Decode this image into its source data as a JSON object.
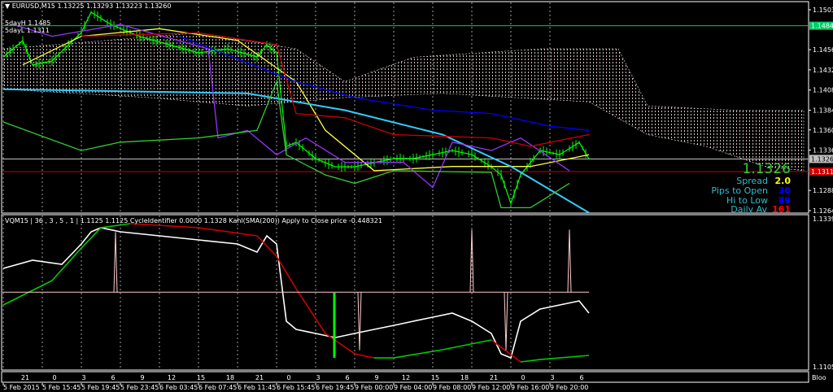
{
  "window": {
    "symbol_header": "EURUSD,M15",
    "ohlc": [
      "1.13225",
      "1.13293",
      "1.13223",
      "1.13260"
    ]
  },
  "labels": {
    "five_day_high": "5dayH 1.1485",
    "five_day_low": "5dayL 1.1311"
  },
  "info_panel": {
    "price": "1.1326",
    "rows": [
      {
        "label": "Spread",
        "value": "2.0",
        "color": "#ffff00"
      },
      {
        "label": "Pips to Open",
        "value": "30",
        "color": "#0000ff"
      },
      {
        "label": "Hi to Low",
        "value": "89",
        "color": "#0000ff"
      },
      {
        "label": "Daily Av",
        "value": "161",
        "color": "#ff0000"
      }
    ]
  },
  "indicator_header": "VQM15 | 36 , 3 , 5 , 1 |  1.1125 1.1125  CycleIdentifier 0.0000 1.1328  Kahl(SMA(200)) Apply to Close price -0.448321",
  "chart_data": [
    {
      "type": "line",
      "title": "EURUSD,M15",
      "ylim": [
        1.12645,
        1.15035
      ],
      "price_ticks": [
        "1.15035",
        "1.14560",
        "1.14320",
        "1.14080",
        "1.13840",
        "1.13605",
        "1.13365",
        "1.12885",
        "1.12645"
      ],
      "hlines": [
        {
          "name": "5day-high",
          "value": 1.14845,
          "label": "1.14845",
          "color": "#00cc66"
        },
        {
          "name": "bid",
          "value": 1.1326,
          "label": "1.13260",
          "color": "#c0c0c0"
        },
        {
          "name": "5day-low",
          "value": 1.1311,
          "label": "1.13110",
          "color": "#cc0000"
        }
      ],
      "series": [
        {
          "name": "price",
          "color": "#00ff00",
          "points": [
            [
              0,
              1.14474
            ],
            [
              1,
              1.1457
            ],
            [
              2,
              1.14667
            ],
            [
              3,
              1.14377
            ],
            [
              5,
              1.14425
            ],
            [
              8,
              1.14764
            ],
            [
              9,
              1.15006
            ],
            [
              11,
              1.14861
            ],
            [
              14,
              1.14716
            ],
            [
              17,
              1.14619
            ],
            [
              20,
              1.14522
            ],
            [
              23,
              1.1457
            ],
            [
              26,
              1.14474
            ],
            [
              27,
              1.14619
            ],
            [
              28,
              1.14522
            ],
            [
              29,
              1.13409
            ],
            [
              30,
              1.13457
            ],
            [
              32,
              1.13264
            ],
            [
              34,
              1.13167
            ],
            [
              36,
              1.13167
            ],
            [
              38,
              1.13215
            ],
            [
              40,
              1.13264
            ],
            [
              42,
              1.13264
            ],
            [
              44,
              1.13312
            ],
            [
              46,
              1.1336
            ],
            [
              48,
              1.13312
            ],
            [
              50,
              1.13167
            ],
            [
              51,
              1.1307
            ],
            [
              52,
              1.12731
            ],
            [
              53,
              1.1307
            ],
            [
              55,
              1.1336
            ],
            [
              57,
              1.13312
            ],
            [
              59,
              1.13457
            ],
            [
              60,
              1.1326
            ]
          ]
        },
        {
          "name": "yellow-ma",
          "color": "#ffff40",
          "points": [
            [
              2,
              1.1438
            ],
            [
              8,
              1.1472
            ],
            [
              16,
              1.1481
            ],
            [
              24,
              1.1467
            ],
            [
              30,
              1.1418
            ],
            [
              33,
              1.136
            ],
            [
              38,
              1.1312
            ],
            [
              46,
              1.1317
            ],
            [
              54,
              1.1317
            ],
            [
              60,
              1.1331
            ]
          ]
        },
        {
          "name": "cyan-ma",
          "color": "#33ccff",
          "points": [
            [
              0,
              1.1409
            ],
            [
              25,
              1.1404
            ],
            [
              35,
              1.1384
            ],
            [
              45,
              1.1355
            ],
            [
              52,
              1.1317
            ],
            [
              60,
              1.1262
            ]
          ]
        },
        {
          "name": "purple",
          "color": "#9933ff",
          "points": [
            [
              1,
              1.1486
            ],
            [
              5,
              1.1472
            ],
            [
              12,
              1.1486
            ],
            [
              21,
              1.1457
            ],
            [
              22,
              1.1351
            ],
            [
              25,
              1.136
            ],
            [
              28,
              1.1331
            ],
            [
              31,
              1.1351
            ],
            [
              35,
              1.1322
            ],
            [
              41,
              1.1322
            ],
            [
              44,
              1.1292
            ],
            [
              46,
              1.1346
            ],
            [
              50,
              1.1336
            ],
            [
              53,
              1.1351
            ],
            [
              58,
              1.1312
            ]
          ]
        },
        {
          "name": "green-envelope",
          "color": "#33cc33",
          "points": [
            [
              0,
              1.137
            ],
            [
              8,
              1.1336
            ],
            [
              12,
              1.1346
            ],
            [
              20,
              1.1351
            ],
            [
              26,
              1.136
            ],
            [
              28,
              1.1418
            ],
            [
              29,
              1.1331
            ],
            [
              33,
              1.1307
            ],
            [
              36,
              1.1297
            ],
            [
              40,
              1.1312
            ],
            [
              50,
              1.131
            ],
            [
              51,
              1.1268
            ],
            [
              54,
              1.1268
            ],
            [
              58,
              1.1297
            ]
          ]
        },
        {
          "name": "red-envelope",
          "color": "#cc0000",
          "points": [
            [
              8,
              1.1472
            ],
            [
              20,
              1.1476
            ],
            [
              28,
              1.1462
            ],
            [
              30,
              1.138
            ],
            [
              35,
              1.1375
            ],
            [
              40,
              1.1355
            ],
            [
              50,
              1.1351
            ],
            [
              54,
              1.1341
            ],
            [
              60,
              1.1355
            ]
          ]
        },
        {
          "name": "blue-envelope",
          "color": "#0000ff",
          "points": [
            [
              18,
              1.1472
            ],
            [
              30,
              1.1418
            ],
            [
              36,
              1.1399
            ],
            [
              44,
              1.1384
            ],
            [
              50,
              1.138
            ],
            [
              56,
              1.1365
            ],
            [
              60,
              1.136
            ]
          ]
        }
      ],
      "cloud": {
        "upper": [
          [
            0,
            1.1457
          ],
          [
            20,
            1.1476
          ],
          [
            30,
            1.1457
          ],
          [
            35,
            1.1418
          ],
          [
            42,
            1.1447
          ],
          [
            55,
            1.1457
          ],
          [
            63,
            1.1457
          ],
          [
            66,
            1.1389
          ],
          [
            75,
            1.1384
          ],
          [
            82,
            1.1384
          ]
        ],
        "lower": [
          [
            0,
            1.1409
          ],
          [
            15,
            1.1399
          ],
          [
            25,
            1.1389
          ],
          [
            35,
            1.1399
          ],
          [
            45,
            1.1404
          ],
          [
            60,
            1.1394
          ],
          [
            66,
            1.1355
          ],
          [
            72,
            1.1341
          ],
          [
            78,
            1.1317
          ],
          [
            82,
            1.1312
          ]
        ]
      }
    },
    {
      "type": "line",
      "title": "VQM15",
      "ylim": [
        1.1105,
        1.1339
      ],
      "ticks": [
        "1.1339",
        "1.1105"
      ],
      "series": [
        {
          "name": "vq",
          "color": "#ffffff",
          "points": [
            [
              0,
              1.12606
            ],
            [
              3,
              1.12734
            ],
            [
              6,
              1.1267
            ],
            [
              8,
              1.12991
            ],
            [
              9,
              1.13184
            ],
            [
              10,
              1.13249
            ],
            [
              12,
              1.13184
            ],
            [
              16,
              1.1312
            ],
            [
              20,
              1.13056
            ],
            [
              24,
              1.12991
            ],
            [
              26,
              1.12863
            ],
            [
              27,
              1.1312
            ],
            [
              28,
              1.12991
            ],
            [
              29,
              1.1177
            ],
            [
              30,
              1.11641
            ],
            [
              32,
              1.11577
            ],
            [
              34,
              1.11512
            ],
            [
              36,
              1.11577
            ],
            [
              38,
              1.11641
            ],
            [
              40,
              1.11705
            ],
            [
              42,
              1.1177
            ],
            [
              44,
              1.11834
            ],
            [
              46,
              1.11898
            ],
            [
              48,
              1.1177
            ],
            [
              50,
              1.11577
            ],
            [
              51,
              1.11255
            ],
            [
              52,
              1.11191
            ],
            [
              53,
              1.1177
            ],
            [
              55,
              1.11963
            ],
            [
              57,
              1.12027
            ],
            [
              59,
              1.12091
            ],
            [
              60,
              1.11898
            ]
          ]
        },
        {
          "name": "kahl-sma200",
          "up_color": "#00cc00",
          "down_color": "#cc0000",
          "points": [
            [
              0,
              1.12027
            ],
            [
              5,
              1.12413
            ],
            [
              8,
              1.12927
            ],
            [
              10,
              1.13249
            ],
            [
              13,
              1.13313
            ],
            [
              20,
              1.13249
            ],
            [
              26,
              1.1312
            ],
            [
              28,
              1.12798
            ],
            [
              30,
              1.12284
            ],
            [
              33,
              1.11577
            ],
            [
              36,
              1.11255
            ],
            [
              38,
              1.11191
            ],
            [
              40,
              1.11191
            ],
            [
              45,
              1.1132
            ],
            [
              50,
              1.11474
            ],
            [
              53,
              1.11127
            ],
            [
              55,
              1.11165
            ],
            [
              60,
              1.1123
            ]
          ]
        },
        {
          "name": "cycle-identifier",
          "color": "#ffcccc",
          "baseline": 1.1223,
          "spikes": [
            [
              11.5,
              1.1318
            ],
            [
              48,
              1.1322
            ],
            [
              58,
              1.1322
            ]
          ],
          "dips": [
            [
              36.5,
              1.1131
            ],
            [
              51.5,
              1.1131
            ]
          ]
        }
      ]
    }
  ],
  "time_axis": {
    "hours": [
      "21",
      "0",
      "3",
      "6",
      "9",
      "12",
      "15",
      "18",
      "21",
      "0",
      "3",
      "6",
      "9",
      "12",
      "15",
      "18",
      "21",
      "0",
      "3",
      "6"
    ],
    "dates": [
      "5 Feb 2015",
      "5 Feb 15:45",
      "5 Feb 19:45",
      "5 Feb 23:45",
      "6 Feb 03:45",
      "6 Feb 07:45",
      "6 Feb 11:45",
      "6 Feb 15:45",
      "6 Feb 19:45",
      "9 Feb 00:00",
      "9 Feb 04:00",
      "9 Feb 08:00",
      "9 Feb 12:00",
      "9 Feb 16:00",
      "9 Feb 20:00"
    ],
    "corner": "Bloo"
  }
}
